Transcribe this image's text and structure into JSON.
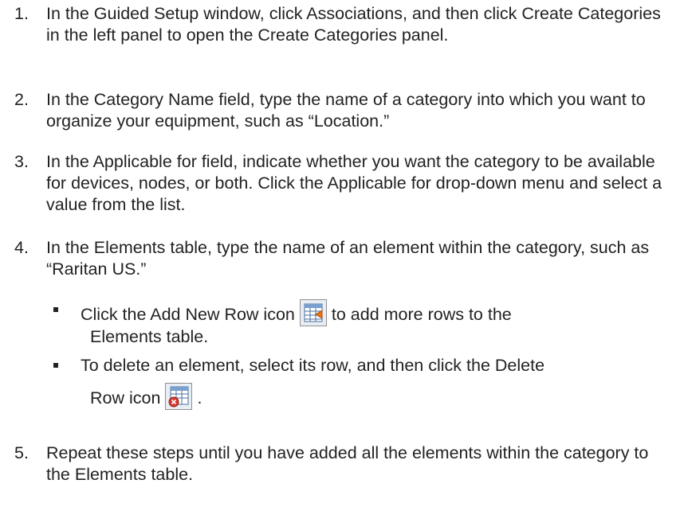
{
  "steps": [
    {
      "num": "1.",
      "text": "In the Guided Setup window, click Associations, and then click Create Categories in the left panel to open the Create Categories panel."
    },
    {
      "num": "2.",
      "text": "In the Category Name field, type the name of a category into which you want to organize your equipment, such as “Location.”"
    },
    {
      "num": "3.",
      "text": "In the Applicable for field, indicate whether you want the category to be available for devices, nodes, or both. Click the Applicable for drop-down menu and select a value from the list."
    },
    {
      "num": "4.",
      "text": "In the Elements table, type the name of an element within the category, such as “Raritan US.”"
    },
    {
      "num": "5.",
      "text": "Repeat these steps until you have added all the elements within the category to the Elements table."
    }
  ],
  "bullets": {
    "add_row": {
      "before": "Click the Add New Row icon",
      "after_line1": "to add more rows to the",
      "after_line2": "Elements table.",
      "icon": "add-row-icon"
    },
    "delete_row": {
      "line1": "To delete an element, select its row, and then click the Delete",
      "line2_before": "Row icon",
      "line2_after": ".",
      "icon": "delete-row-icon"
    }
  }
}
